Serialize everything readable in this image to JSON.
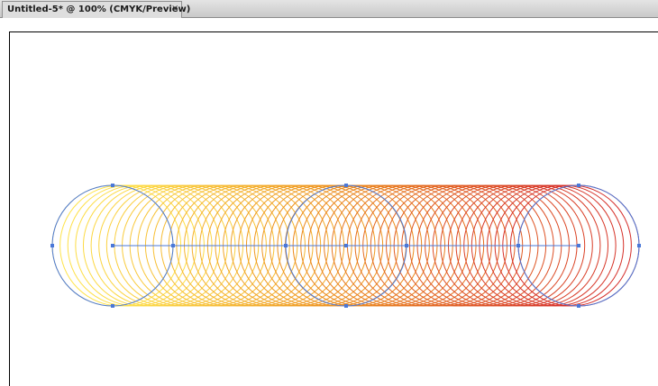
{
  "tab": {
    "title": "Untitled-5* @ 100% (CMYK/Preview)",
    "close": "×"
  },
  "artwork": {
    "blend_steps": 60,
    "colors": {
      "start": "#ffe64a",
      "middle": "#ec8c1a",
      "end": "#d42a2a",
      "selection": "#4a78d8"
    },
    "icons": [
      "close-icon"
    ]
  }
}
